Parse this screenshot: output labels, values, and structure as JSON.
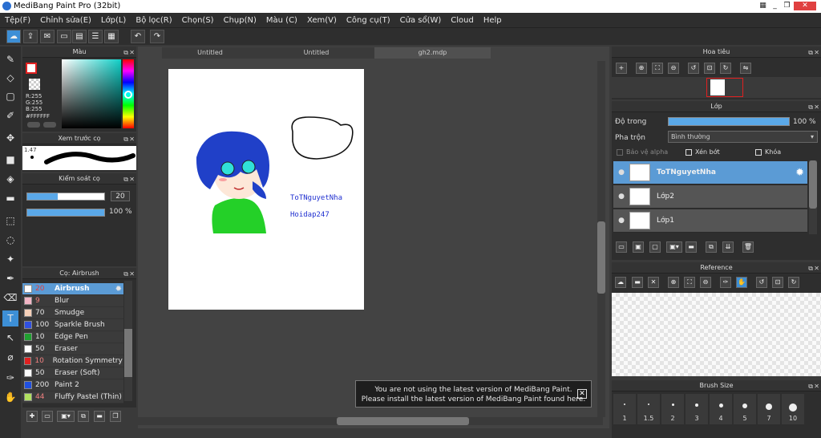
{
  "window": {
    "title": "MediBang Paint Pro (32bit)"
  },
  "menu": [
    "Tệp(F)",
    "Chỉnh sửa(E)",
    "Lớp(L)",
    "Bộ lọc(R)",
    "Chọn(S)",
    "Chụp(N)",
    "Màu (C)",
    "Xem(V)",
    "Công cụ(T)",
    "Cửa sổ(W)",
    "Cloud",
    "Help"
  ],
  "tabs": [
    "Untitled",
    "Untitled",
    "gh2.mdp"
  ],
  "color_panel": {
    "title": "Màu",
    "rgb": "R:255\nG:255\nB:255",
    "hex": "#FFFFFF"
  },
  "brush_preview": {
    "title": "Xem trước cọ",
    "size": "1.47"
  },
  "control": {
    "title": "Kiểm soát cọ",
    "size_value": "20",
    "opacity_value": "100 %"
  },
  "brushes": {
    "title": "Cọ: Airbrush",
    "items": [
      {
        "size": "20",
        "name": "Airbrush",
        "color": "#ffffff"
      },
      {
        "size": "9",
        "name": "Blur",
        "color": "#f4b6c6"
      },
      {
        "size": "70",
        "name": "Smudge",
        "color": "#f6d0b8"
      },
      {
        "size": "100",
        "name": "Sparkle Brush",
        "color": "#3050e0"
      },
      {
        "size": "10",
        "name": "Edge Pen",
        "color": "#20a030"
      },
      {
        "size": "50",
        "name": "Eraser",
        "color": "#ffffff"
      },
      {
        "size": "10",
        "name": "Rotation Symmetry P",
        "color": "#e02020"
      },
      {
        "size": "50",
        "name": "Eraser (Soft)",
        "color": "#ffffff"
      },
      {
        "size": "200",
        "name": "Paint 2",
        "color": "#2050e0"
      },
      {
        "size": "44",
        "name": "Fluffy Pastel (Thin)",
        "color": "#b0e060"
      }
    ]
  },
  "canvas_text": {
    "line1": "ToTNguyetNha",
    "line2": "Hoidap247"
  },
  "navigator": {
    "title": "Hoa tiêu"
  },
  "layers": {
    "title": "Lớp",
    "opacity_label": "Độ trong",
    "opacity_value": "100 %",
    "blend_label": "Pha trộn",
    "blend_value": "Bình thường",
    "protect_alpha": "Bảo vệ alpha",
    "clipping": "Xén bớt",
    "lock": "Khóa",
    "items": [
      {
        "name": "ToTNguyetNha",
        "selected": true
      },
      {
        "name": "Lớp2",
        "selected": false
      },
      {
        "name": "Lớp1",
        "selected": false
      }
    ]
  },
  "reference": {
    "title": "Reference"
  },
  "brush_size": {
    "title": "Brush Size",
    "sizes": [
      "1",
      "1.5",
      "2",
      "3",
      "4",
      "5",
      "7",
      "10"
    ]
  },
  "notification": {
    "line1": "You are not using the latest version of MediBang Paint.",
    "line2": "Please install the latest version of MediBang Paint found here."
  },
  "colors": {
    "accent": "#3d8fd6",
    "selected_layer": "#5b9bd5",
    "panel": "#2e2e2e"
  }
}
